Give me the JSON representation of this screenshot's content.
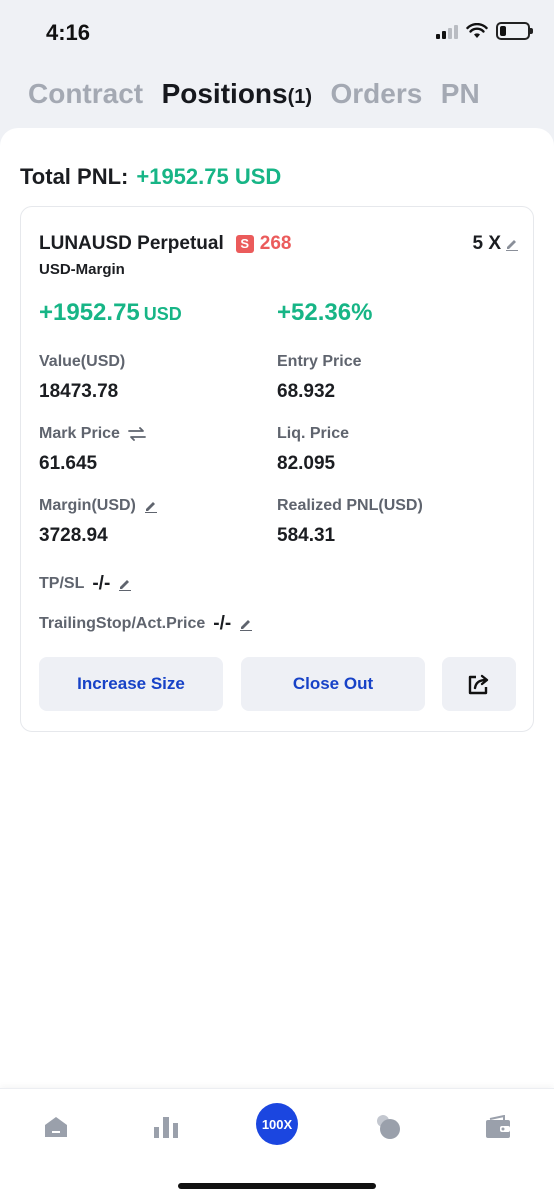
{
  "status": {
    "time": "4:16"
  },
  "tabs": [
    {
      "label": "Contract"
    },
    {
      "label": "Positions",
      "count": "(1)"
    },
    {
      "label": "Orders"
    },
    {
      "label": "PN"
    }
  ],
  "total_pnl": {
    "label": "Total PNL:",
    "value": "+1952.75 USD"
  },
  "position": {
    "symbol": "LUNAUSD Perpetual",
    "side_badge": "S",
    "quantity": "268",
    "leverage": "5 X",
    "margin_type": "USD-Margin",
    "unrealized_pnl": "+1952.75",
    "unrealized_pnl_unit": "USD",
    "roi": "+52.36%",
    "value_label": "Value(USD)",
    "value": "18473.78",
    "entry_price_label": "Entry Price",
    "entry_price": "68.932",
    "mark_price_label": "Mark Price",
    "mark_price": "61.645",
    "liq_price_label": "Liq. Price",
    "liq_price": "82.095",
    "margin_label": "Margin(USD)",
    "margin": "3728.94",
    "realized_pnl_label": "Realized PNL(USD)",
    "realized_pnl": "584.31",
    "tpsl_label": "TP/SL",
    "tpsl_value": "-/-",
    "trailing_label": "TrailingStop/Act.Price",
    "trailing_value": "-/-"
  },
  "buttons": {
    "increase": "Increase Size",
    "close": "Close Out"
  },
  "nav": {
    "center_label": "100X"
  },
  "colors": {
    "profit": "#17b586",
    "sell": "#eb5b5b",
    "accent": "#1742c7",
    "nav_accent": "#1b46e0"
  }
}
